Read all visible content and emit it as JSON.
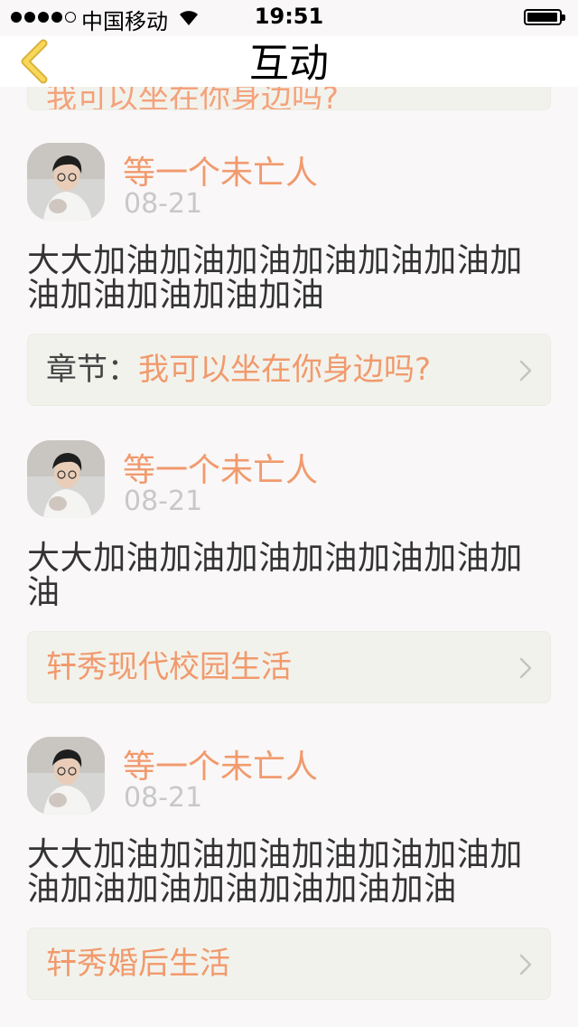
{
  "status_bar": {
    "carrier": "中国移动",
    "time": "19:51"
  },
  "nav": {
    "title": "互动"
  },
  "previous_item": {
    "chapter_partial": "我可以坐在你身边吗?"
  },
  "comments": [
    {
      "user": "等一个未亡人",
      "date": "08-21",
      "text": "大大加油加油加油加油加油加油加油加油加油加油加油",
      "chapter_prefix": "章节：",
      "chapter_title": "我可以坐在你身边吗?"
    },
    {
      "user": "等一个未亡人",
      "date": "08-21",
      "text": "大大加油加油加油加油加油加油加油",
      "chapter_prefix": "",
      "chapter_title": "轩秀现代校园生活"
    },
    {
      "user": "等一个未亡人",
      "date": "08-21",
      "text": "大大加油加油加油加油加油加油加油加油加油加油加油加油加油",
      "chapter_prefix": "",
      "chapter_title": "轩秀婚后生活"
    }
  ],
  "icons": {
    "back": "chevron-left-icon",
    "disclosure": "chevron-right-icon",
    "wifi": "wifi-icon",
    "battery": "battery-icon"
  },
  "colors": {
    "accent": "#f19a6d",
    "back_icon": "#f2c43a",
    "date": "#c8c8c8",
    "body_text": "#333333",
    "card_bg": "#f2f2ec",
    "page_bg": "#f9f7f7"
  }
}
